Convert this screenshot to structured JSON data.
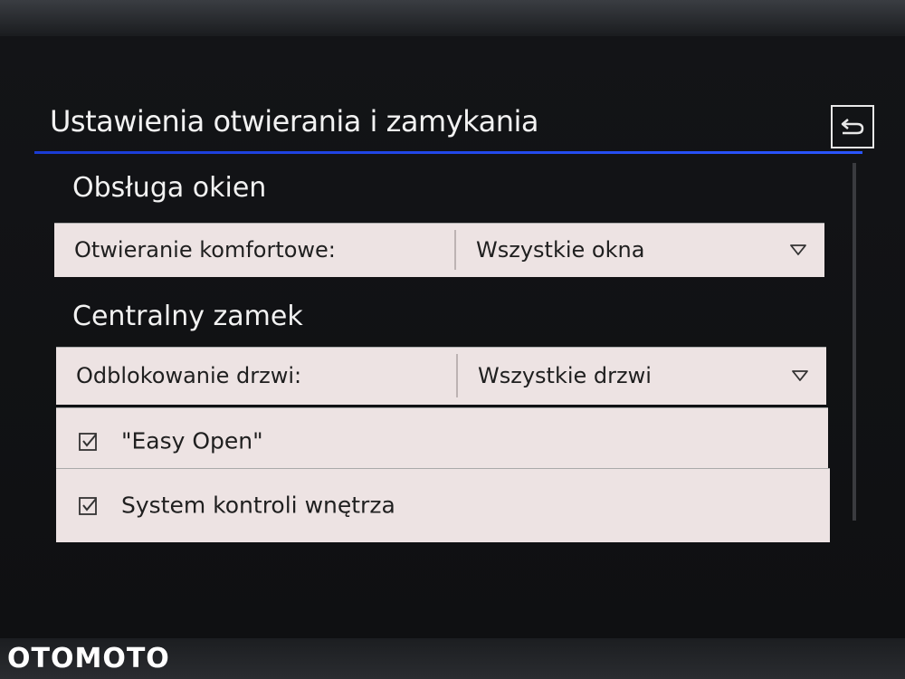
{
  "header": {
    "title": "Ustawienia otwierania i zamykania",
    "back_icon": "back-arrow-icon"
  },
  "sections": [
    {
      "title": "Obsługa okien",
      "rows": [
        {
          "label": "Otwieranie komfortowe:",
          "value": "Wszystkie okna"
        }
      ]
    },
    {
      "title": "Centralny zamek",
      "rows": [
        {
          "label": "Odblokowanie drzwi:",
          "value": "Wszystkie drzwi"
        }
      ],
      "checkboxes": [
        {
          "label": "\"Easy Open\"",
          "checked": true
        },
        {
          "label": "System kontroli wnętrza",
          "checked": true
        }
      ]
    }
  ],
  "watermark": "OTOMOTO",
  "colors": {
    "accent_line": "#2a55ff",
    "row_bg": "#ede3e3",
    "screen_bg": "#0f1012"
  }
}
